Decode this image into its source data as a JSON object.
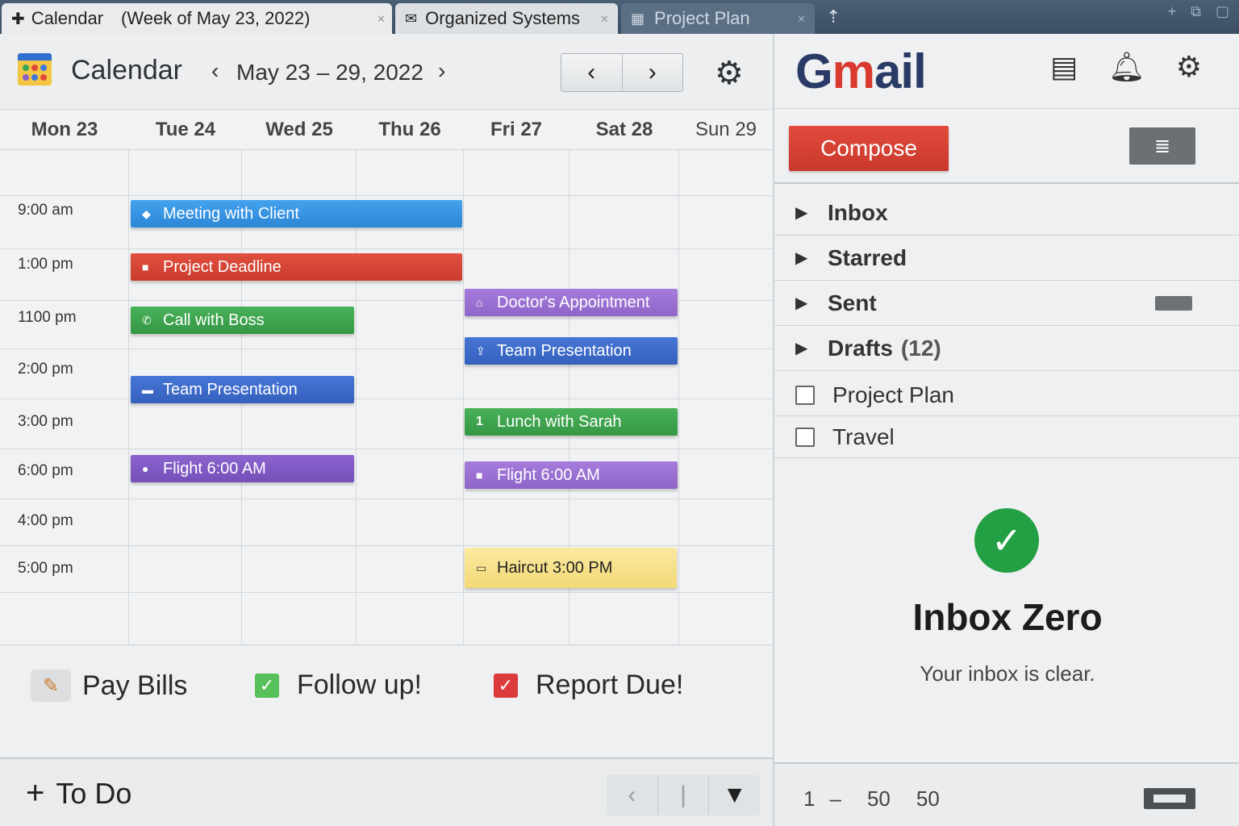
{
  "tabs": [
    {
      "label": "Calendar",
      "sub": "(Week of May 23, 2022)",
      "icon": "pin-icon"
    },
    {
      "label": "Organized Systems",
      "icon": "mail-icon"
    },
    {
      "label": "Project Plan",
      "icon": "doc-icon"
    }
  ],
  "calendar": {
    "title": "Calendar",
    "range": "May 23 – 29, 2022",
    "days": [
      "Mon 23",
      "Tue 24",
      "Wed 25",
      "Thu 26",
      "Fri 27",
      "Sat 28",
      "Sun 29"
    ],
    "times": [
      "9:00 am",
      "1:00 pm",
      "1100 pm",
      "2:00 pm",
      "3:00 pm",
      "6:00 pm",
      "4:00 pm",
      "5:00 pm"
    ],
    "events": [
      {
        "label": "Meeting with Client"
      },
      {
        "label": "Project Deadline"
      },
      {
        "label": "Call with Boss"
      },
      {
        "label": "Team Presentation"
      },
      {
        "label": "Flight 6:00 AM"
      },
      {
        "label": "Doctor's Appointment"
      },
      {
        "label": "Team Presentation"
      },
      {
        "label": "Lunch with Sarah"
      },
      {
        "label": "Flight 6:00 AM"
      },
      {
        "label": "Haircut 3:00 PM"
      }
    ],
    "todos": [
      {
        "label": "Pay Bills",
        "checked": false
      },
      {
        "label": "Follow up!",
        "checked": true
      },
      {
        "label": "Report Due!",
        "checked": true
      }
    ],
    "todo_add": "To Do"
  },
  "gmail": {
    "logo_g": "G",
    "logo_m": "m",
    "logo_rest": "ail",
    "compose": "Compose",
    "nav": [
      {
        "label": "Inbox",
        "count": ""
      },
      {
        "label": "Starred",
        "count": ""
      },
      {
        "label": "Sent",
        "count": ""
      },
      {
        "label": "Drafts",
        "count": "(12)"
      }
    ],
    "labels": [
      "Project Plan",
      "Travel"
    ],
    "zero_title": "Inbox Zero",
    "zero_sub": "Your inbox is clear.",
    "pager": {
      "start": "1",
      "dash": "–",
      "end": "50",
      "total": "50"
    }
  },
  "colors": {
    "compose": "#d9392e",
    "event_blue": "#2c87d6",
    "event_red": "#c93b2d",
    "event_green": "#359744",
    "event_navy": "#3560bd",
    "event_purple": "#7450b8",
    "event_yellow": "#f3d877",
    "check_green": "#24a044"
  }
}
